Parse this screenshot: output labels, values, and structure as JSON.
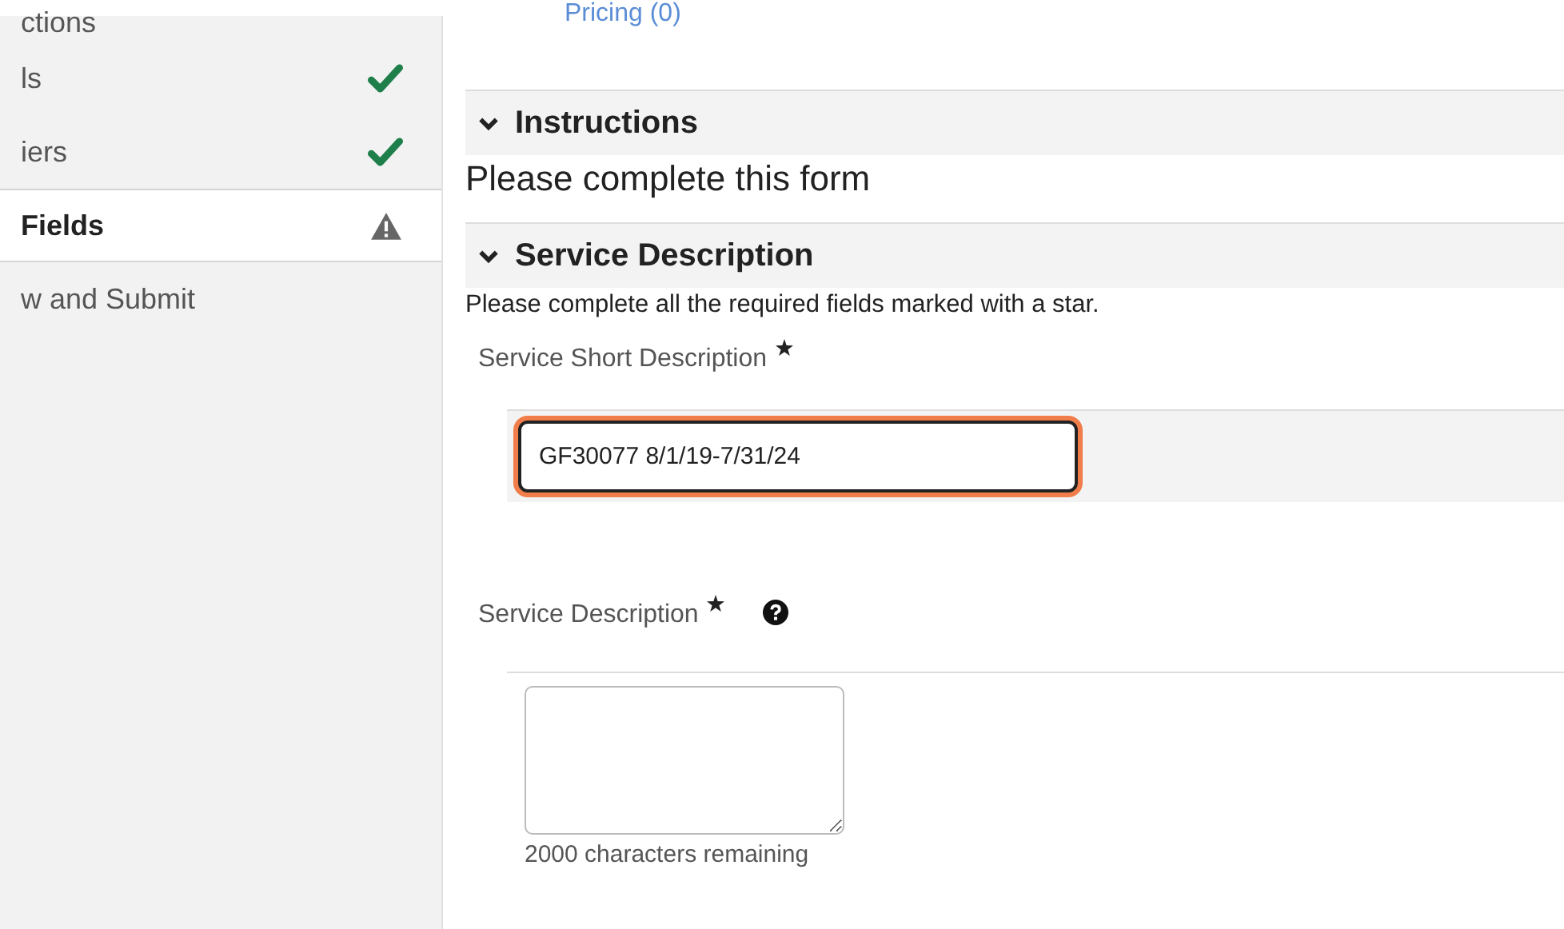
{
  "sidebar": {
    "items": [
      {
        "label": "ctions",
        "selected": false,
        "complete": false,
        "warning": false
      },
      {
        "label": "ls",
        "selected": false,
        "complete": true,
        "warning": false
      },
      {
        "label": "iers",
        "selected": false,
        "complete": true,
        "warning": false
      },
      {
        "label": "Fields",
        "selected": true,
        "complete": false,
        "warning": true
      },
      {
        "label": "w and Submit",
        "selected": false,
        "complete": false,
        "warning": false
      }
    ]
  },
  "top_link": "Pricing (0)",
  "sections": [
    {
      "title": "Instructions",
      "expanded": true,
      "text": "Please complete this form"
    },
    {
      "title": "Service Description",
      "expanded": true,
      "text": "Please complete all the required fields marked with a star.",
      "fields": [
        {
          "kind": "input",
          "label": "Service Short Description",
          "required": true,
          "help": false,
          "value": "GF30077 8/1/19-7/31/24",
          "focused": true
        },
        {
          "kind": "textarea",
          "label": "Service Description",
          "required": true,
          "help": true,
          "counter": "2000 characters remaining",
          "focused": false
        }
      ]
    }
  ]
}
